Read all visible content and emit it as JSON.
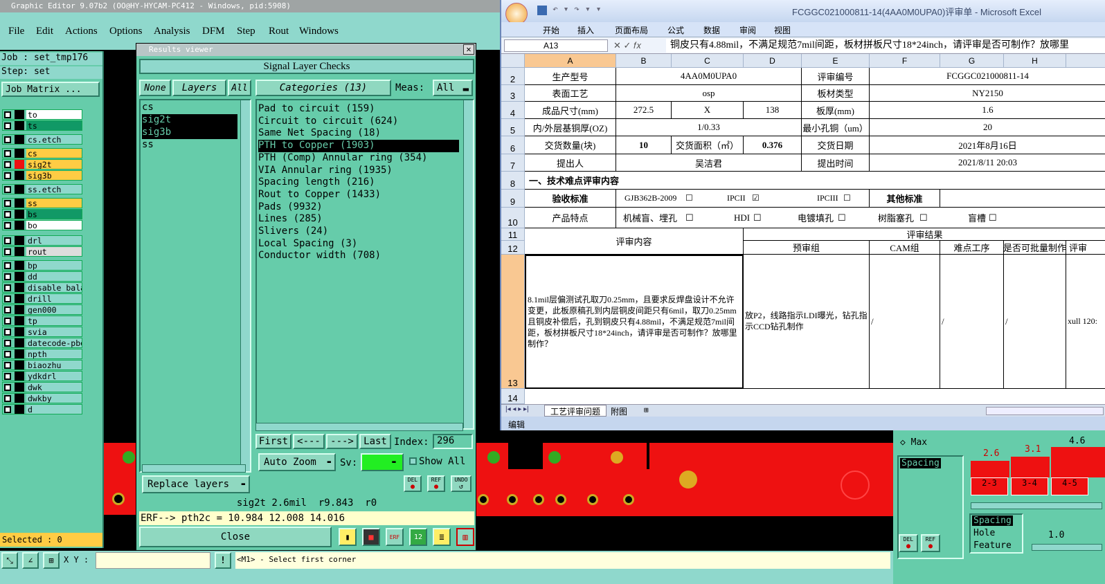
{
  "ge": {
    "title": "Graphic Editor 9.07b2 (OO@HY-HYCAM-PC412 - Windows, pid:5908)",
    "menu": [
      "File",
      "Edit",
      "Actions",
      "Options",
      "Analysis",
      "DFM",
      "Step",
      "Rout",
      "Windows"
    ],
    "job": "Job : set_tmp176",
    "step": "Step: set",
    "job_matrix": "Job Matrix ...",
    "layers": [
      {
        "name": "to",
        "bg": "#ffffff",
        "sw": "#000000"
      },
      {
        "name": "ts",
        "bg": "#119966",
        "sw": "#000000"
      },
      {
        "name": "cs.etch",
        "bg": "#8fd8cc",
        "sw": "#000000"
      },
      {
        "name": "cs",
        "bg": "#ffcc44",
        "sw": "#000000"
      },
      {
        "name": "sig2t",
        "bg": "#ffcc44",
        "sw": "#ee1111"
      },
      {
        "name": "sig3b",
        "bg": "#ffcc44",
        "sw": "#000000"
      },
      {
        "name": "ss.etch",
        "bg": "#8fd8cc",
        "sw": "#000000"
      },
      {
        "name": "ss",
        "bg": "#ffcc44",
        "sw": "#000000"
      },
      {
        "name": "bs",
        "bg": "#119966",
        "sw": "#000000"
      },
      {
        "name": "bo",
        "bg": "#ffffff",
        "sw": "#000000"
      },
      {
        "name": "drl",
        "bg": "#8fd8cc",
        "sw": "#000000"
      },
      {
        "name": "rout",
        "bg": "#dddddd",
        "sw": "#000000"
      },
      {
        "name": "bp",
        "bg": "#8fd8cc",
        "sw": "#000000"
      },
      {
        "name": "dd",
        "bg": "#8fd8cc",
        "sw": "#000000"
      },
      {
        "name": "disable_bala",
        "bg": "#8fd8cc",
        "sw": "#000000"
      },
      {
        "name": "drill",
        "bg": "#8fd8cc",
        "sw": "#000000"
      },
      {
        "name": "gen000",
        "bg": "#8fd8cc",
        "sw": "#000000"
      },
      {
        "name": "tp",
        "bg": "#8fd8cc",
        "sw": "#000000"
      },
      {
        "name": "svia",
        "bg": "#8fd8cc",
        "sw": "#000000"
      },
      {
        "name": "datecode-pbe",
        "bg": "#8fd8cc",
        "sw": "#000000"
      },
      {
        "name": "npth",
        "bg": "#8fd8cc",
        "sw": "#000000"
      },
      {
        "name": "biaozhu",
        "bg": "#8fd8cc",
        "sw": "#000000"
      },
      {
        "name": "ydkdrl",
        "bg": "#8fd8cc",
        "sw": "#000000"
      },
      {
        "name": "dwk",
        "bg": "#8fd8cc",
        "sw": "#000000"
      },
      {
        "name": "dwkby",
        "bg": "#8fd8cc",
        "sw": "#000000"
      },
      {
        "name": "d",
        "bg": "#8fd8cc",
        "sw": "#000000"
      }
    ],
    "selected": "Selected : 0",
    "xy_label": "X Y :",
    "prompt": "<M1> - Select first corner"
  },
  "rv": {
    "title": "Results viewer",
    "header": "Signal Layer Checks",
    "none": "None",
    "layers": "Layers",
    "all": "All",
    "categories_btn": "Categories (13)",
    "meas_label": "Meas:",
    "meas_value": "All",
    "layer_list": [
      "cs",
      "sig2t",
      "sig3b",
      "ss"
    ],
    "categories": [
      "Pad to circuit (159)",
      "Circuit to circuit (624)",
      "Same Net Spacing (18)",
      "PTH to Copper (1903)",
      "PTH (Comp) Annular ring (354)",
      "VIA Annular ring (1935)",
      "Spacing length (216)",
      "Rout to Copper (1433)",
      "Pads (9932)",
      "Lines (285)",
      "Slivers (24)",
      "Local Spacing (3)",
      "Conductor width (708)"
    ],
    "first": "First",
    "prev": "<---",
    "next": "--->",
    "last": "Last",
    "index_label": "Index:",
    "index_value": "296",
    "auto_zoom": "Auto Zoom",
    "sv": "Sv:",
    "show_all": "Show All",
    "replace": "Replace layers",
    "status": "sig2t 2.6mil  r9.843  r0",
    "erf": "ERF--> pth2c = 10.984 12.008 14.016",
    "close": "Close"
  },
  "xl": {
    "title": "FCGGC021000811-14(4AA0M0UPA0)评审单 - Microsoft Excel",
    "tabs": [
      "开始",
      "插入",
      "页面布局",
      "公式",
      "数据",
      "审阅",
      "视图"
    ],
    "cellref": "A13",
    "formula": "铜皮只有4.88mil，不满足规范7mil间距，板材拼板尺寸18*24inch，请评审是否可制作？放哪里",
    "cols": [
      "A",
      "B",
      "C",
      "D",
      "E",
      "F",
      "G",
      "H"
    ],
    "r2": [
      "生产型号",
      "4AA0M0UPA0",
      "评审编号",
      "FCGGC021000811-14"
    ],
    "r3": [
      "表面工艺",
      "osp",
      "板材类型",
      "NY2150"
    ],
    "r4": [
      "成品尺寸(mm)",
      "272.5",
      "X",
      "138",
      "板厚(mm)",
      "1.6"
    ],
    "r5": [
      "内/外层基铜厚(OZ)",
      "1/0.33",
      "最小孔铜（um）",
      "20"
    ],
    "r6": [
      "交货数量(块)",
      "10",
      "交货面积（㎡）",
      "0.376",
      "交货日期",
      "2021年8月16日"
    ],
    "r7": [
      "提出人",
      "吴洁君",
      "提出时间",
      "2021/8/11 20:03"
    ],
    "r8": "一、技术难点评审内容",
    "r9": [
      "验收标准",
      "GJB362B-2009",
      "IPCII",
      "IPCIII",
      "其他标准"
    ],
    "r10": [
      "产品特点",
      "机械盲、埋孔",
      "HDI",
      "电镀填孔",
      "树脂塞孔",
      "盲槽"
    ],
    "r11": [
      "评审内容",
      "评审结果"
    ],
    "r12": [
      "预审组",
      "CAM组",
      "难点工序",
      "是否可批量制作",
      "评审"
    ],
    "r13_a": "8.1mil层偏测试孔取刀0.25mm，且要求反焊盘设计不允许变更，此板原稿孔到内层铜皮间距只有6mil，取刀0.25mm且铜皮补偿后，孔到铜皮只有4.88mil，不满足规范7mil间距，板材拼板尺寸18*24inch，请评审是否可制作？放哪里制作？",
    "r13_d": "放P2，线路指示LDI曝光，钻孔指示CCD钻孔制作",
    "r13_slash": "/",
    "r13_h": "xull 120:",
    "sheets": [
      "工艺评审问题",
      "附图"
    ],
    "status": "编辑"
  },
  "rp": {
    "max": "Max",
    "spacing": "Spacing",
    "bars": [
      "2.6",
      "3.1",
      "4.6"
    ],
    "ranges": [
      "2-3",
      "3-4",
      "4-5"
    ],
    "list": [
      "Spacing",
      "Hole",
      "Feature"
    ],
    "value": "1.0"
  }
}
